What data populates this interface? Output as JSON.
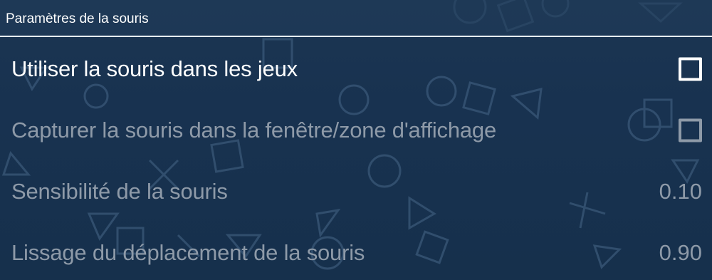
{
  "header": {
    "title": "Paramètres de la souris"
  },
  "settings": [
    {
      "label": "Utiliser la souris dans les jeux",
      "type": "checkbox",
      "checked": false,
      "enabled": true
    },
    {
      "label": "Capturer la souris dans la fenêtre/zone d'affichage",
      "type": "checkbox",
      "checked": false,
      "enabled": false
    },
    {
      "label": "Sensibilité de la souris",
      "type": "value",
      "value": "0.10",
      "enabled": false
    },
    {
      "label": "Lissage du déplacement de la souris",
      "type": "value",
      "value": "0.90",
      "enabled": false
    }
  ],
  "colors": {
    "background": "#183250",
    "text_enabled": "#ffffff",
    "text_disabled": "#8e9aa8",
    "header_divider": "#e6edf5"
  }
}
